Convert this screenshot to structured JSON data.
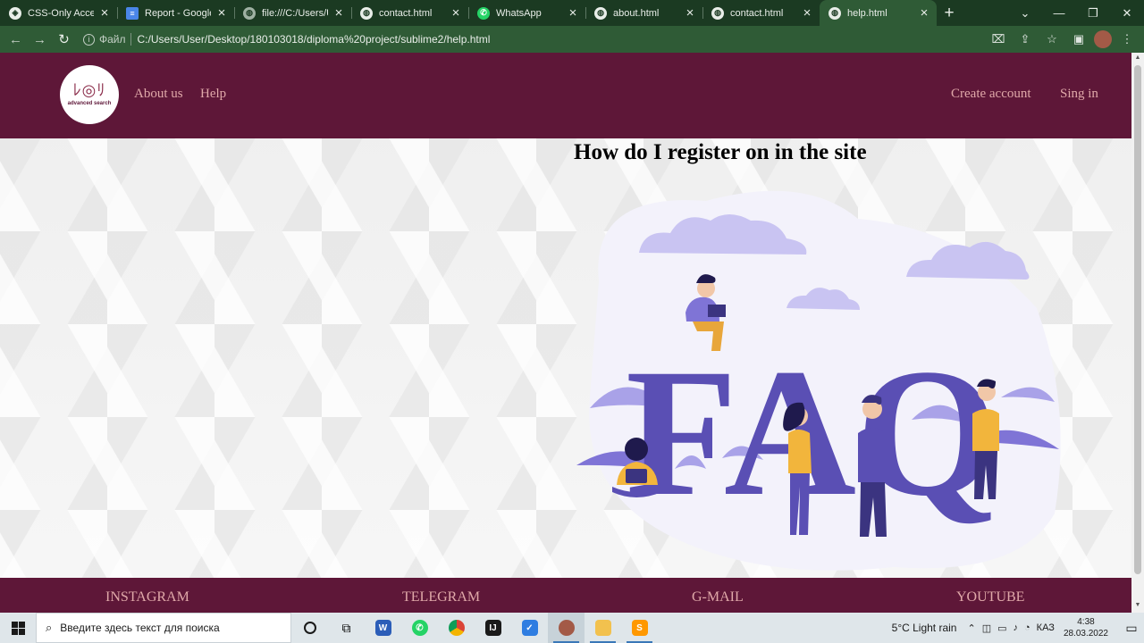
{
  "browser": {
    "tabs": [
      {
        "title": "CSS-Only Accessi",
        "icon": "codepen-icon",
        "active": false
      },
      {
        "title": "Report - Google D",
        "icon": "google-docs-icon",
        "active": false
      },
      {
        "title": "file:///C:/Users/U",
        "icon": "globe-icon",
        "active": false
      },
      {
        "title": "contact.html",
        "icon": "globe-icon",
        "active": false
      },
      {
        "title": "WhatsApp",
        "icon": "whatsapp-icon",
        "active": false
      },
      {
        "title": "about.html",
        "icon": "globe-icon",
        "active": false
      },
      {
        "title": "contact.html",
        "icon": "globe-icon",
        "active": false
      },
      {
        "title": "help.html",
        "icon": "globe-icon",
        "active": true
      }
    ],
    "address": {
      "scheme_label": "Файл",
      "url": "C:/Users/User/Desktop/180103018/diploma%20project/sublime2/help.html"
    }
  },
  "site": {
    "logo_text": "advanced search",
    "nav_left": [
      "About us",
      "Help"
    ],
    "nav_right": [
      "Create account",
      "Sing in"
    ],
    "question": "How do I register on in the site",
    "footer_links": [
      "INSTAGRAM",
      "TELEGRAM",
      "G-MAIL",
      "YOUTUBE"
    ],
    "illustration_text": "FAQ"
  },
  "taskbar": {
    "search_placeholder": "Введите здесь текст для поиска",
    "weather": "5°C  Light rain",
    "language": "КАЗ",
    "time": "4:38",
    "date": "28.03.2022"
  },
  "colors": {
    "header_bg": "#5e1738",
    "nav_text": "#e0a9a9",
    "illustration_purple": "#5a4fb4",
    "illustration_lavender": "#c9c4f2"
  }
}
